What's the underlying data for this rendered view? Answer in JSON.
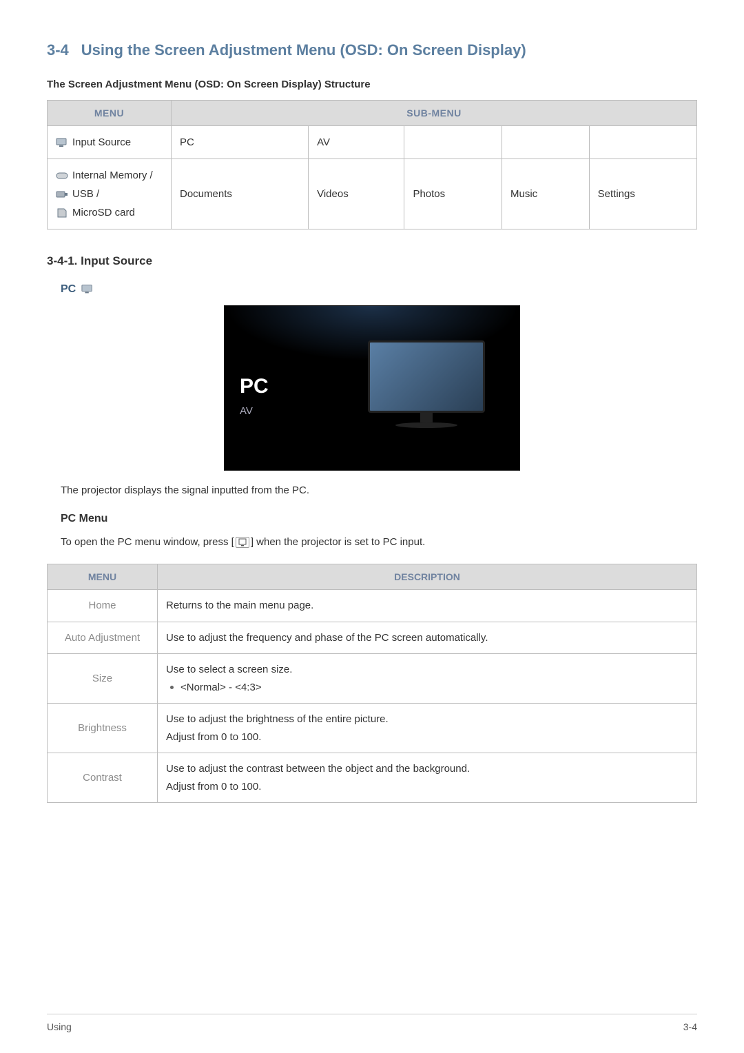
{
  "section": {
    "num": "3-4",
    "title": "Using the Screen Adjustment Menu (OSD: On Screen Display)"
  },
  "struct_heading": "The Screen Adjustment Menu (OSD: On Screen Display) Structure",
  "struct_table": {
    "head_menu": "MENU",
    "head_sub": "SUB-MENU",
    "rows": [
      {
        "menu": "Input Source",
        "menu_icon": "monitor-icon",
        "sub": [
          "PC",
          "AV",
          "",
          "",
          ""
        ]
      },
      {
        "menu_lines": [
          "Internal Memory /",
          "USB /",
          "MicroSD card"
        ],
        "menu_icons": [
          "disk-icon",
          "usb-icon",
          "sd-icon"
        ],
        "sub": [
          "Documents",
          "Videos",
          "Photos",
          "Music",
          "Settings"
        ]
      }
    ]
  },
  "input_source_heading": "3-4-1. Input Source",
  "pc_heading": "PC",
  "osd": {
    "pc": "PC",
    "av": "AV"
  },
  "pc_desc": "The projector displays the signal inputted from the PC.",
  "pc_menu_heading": "PC Menu",
  "pc_menu_intro_pre": "To open the PC menu window, press [",
  "pc_menu_intro_post": "] when the projector is set to PC input.",
  "desc_table": {
    "head_menu": "MENU",
    "head_desc": "DESCRIPTION",
    "rows": [
      {
        "menu": "Home",
        "desc": [
          "Returns to the main menu page."
        ]
      },
      {
        "menu": "Auto Adjustment",
        "desc": [
          "Use to adjust the frequency and phase of the PC screen automatically."
        ]
      },
      {
        "menu": "Size",
        "desc": [
          "Use to select a screen size."
        ],
        "bullet": "<Normal> - <4:3>"
      },
      {
        "menu": "Brightness",
        "desc": [
          "Use to adjust the brightness of the entire picture.",
          "Adjust from 0 to 100."
        ]
      },
      {
        "menu": "Contrast",
        "desc": [
          "Use to adjust the contrast between the object and the background.",
          "Adjust from 0 to 100."
        ]
      }
    ]
  },
  "footer": {
    "left": "Using",
    "right": "3-4"
  },
  "colors": {
    "heading": "#5c7fa0",
    "table_head": "#7083a0"
  }
}
